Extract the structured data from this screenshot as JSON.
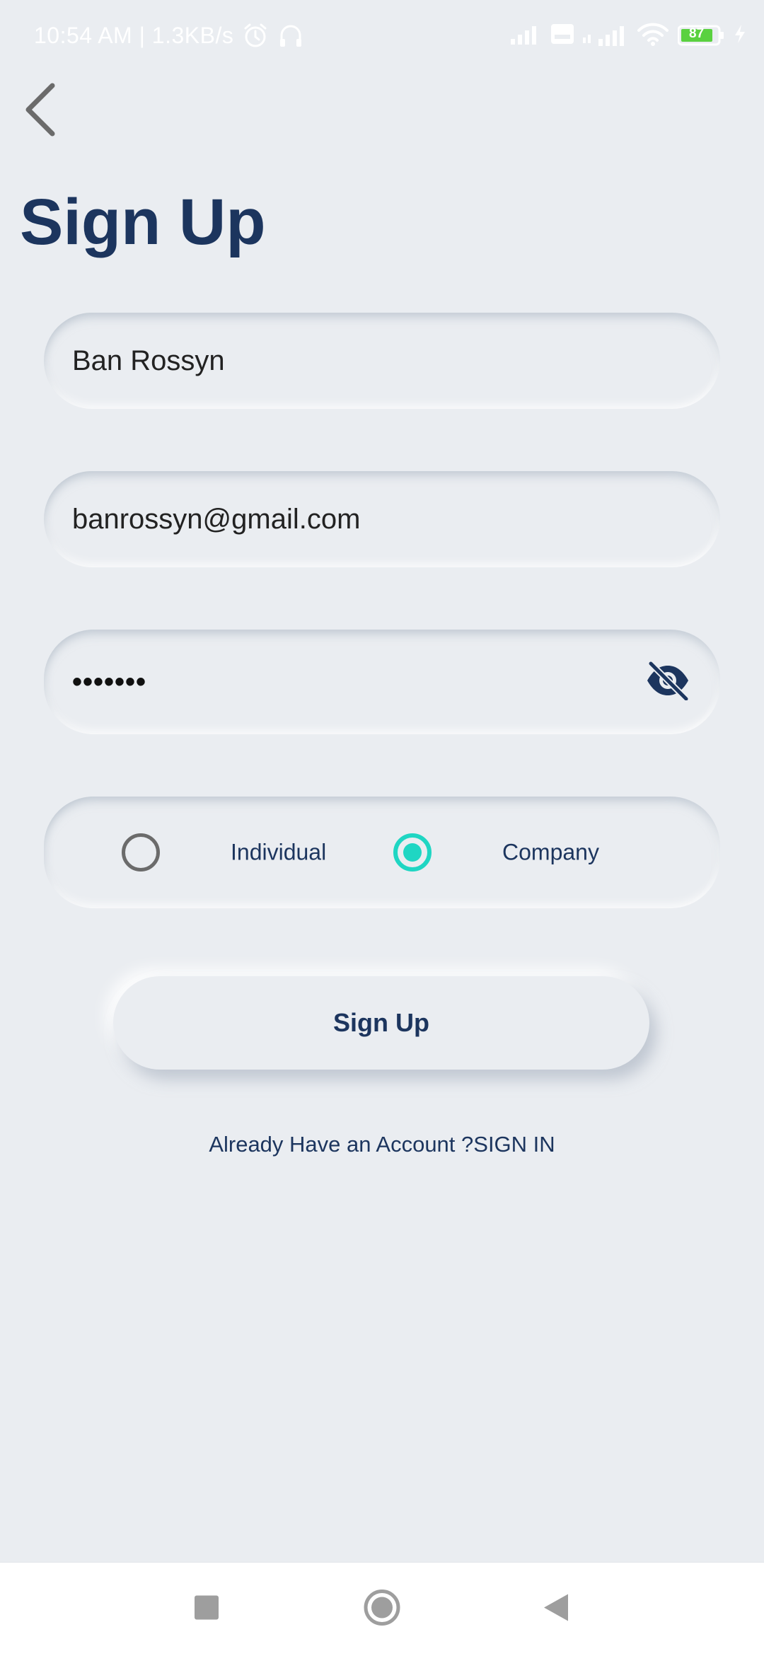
{
  "status_bar": {
    "time_speed": "10:54 AM | 1.3KB/s",
    "battery": "87",
    "icons": [
      "alarm-icon",
      "headset-icon",
      "signal-icon",
      "volte-icon",
      "signal-4g-icon",
      "wifi-icon",
      "battery-icon",
      "charging-icon"
    ]
  },
  "header": {
    "title": "Sign Up",
    "back_icon": "chevron-left-icon"
  },
  "form": {
    "name_value": "Ban Rossyn",
    "email_value": "banrossyn@gmail.com",
    "password_mask": "•••••••",
    "password_toggle_icon": "eye-off-icon",
    "account_type": {
      "options": [
        {
          "label": "Individual",
          "selected": false
        },
        {
          "label": "Company",
          "selected": true
        }
      ]
    },
    "submit_label": "Sign Up",
    "signin_text": "Already Have an Account ?SIGN IN"
  },
  "nav_bar": {
    "icons": [
      "recents-square-icon",
      "home-circle-icon",
      "back-triangle-icon"
    ]
  },
  "colors": {
    "background": "#eaedf1",
    "primary_text": "#1c355e",
    "accent_radio": "#1fd6c3",
    "battery_green": "#5ad140"
  }
}
